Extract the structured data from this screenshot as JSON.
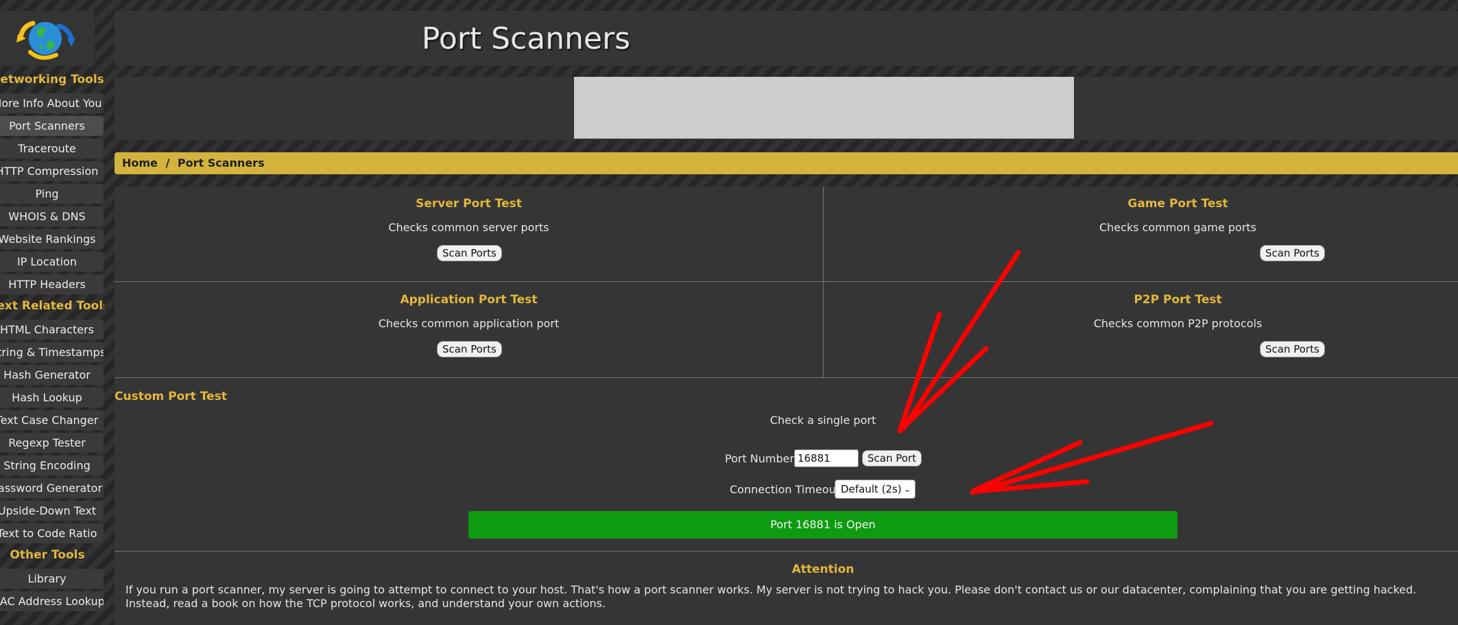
{
  "header": {
    "title": "Port Scanners"
  },
  "breadcrumb": {
    "home": "Home",
    "separator": "/",
    "current": "Port Scanners"
  },
  "sidebar": {
    "sections": [
      {
        "heading": "Networking Tools",
        "items": [
          "More Info About You",
          "Port Scanners",
          "Traceroute",
          "HTTP Compression",
          "Ping",
          "WHOIS & DNS",
          "Website Rankings",
          "IP Location",
          "HTTP Headers"
        ]
      },
      {
        "heading": "Text Related Tools",
        "items": [
          "HTML Characters",
          "String & Timestamps",
          "Hash Generator",
          "Hash Lookup",
          "Text Case Changer",
          "Regexp Tester",
          "String Encoding",
          "Password Generator",
          "Upside-Down Text",
          "Text to Code Ratio"
        ]
      },
      {
        "heading": "Other Tools",
        "items": [
          "Library",
          "MAC Address Lookup"
        ]
      }
    ],
    "active_item": "Port Scanners"
  },
  "tests": {
    "server": {
      "title": "Server Port Test",
      "desc": "Checks common server ports",
      "button": "Scan Ports"
    },
    "game": {
      "title": "Game Port Test",
      "desc": "Checks common game ports",
      "button": "Scan Ports"
    },
    "application": {
      "title": "Application Port Test",
      "desc": "Checks common application port",
      "button": "Scan Ports"
    },
    "p2p": {
      "title": "P2P Port Test",
      "desc": "Checks common P2P protocols",
      "button": "Scan Ports"
    }
  },
  "custom": {
    "title": "Custom Port Test",
    "desc": "Check a single port",
    "port_label": "Port Number:",
    "port_value": "16881",
    "scan_button": "Scan Port",
    "timeout_label": "Connection Timeout:",
    "timeout_value": "Default (2s)",
    "result": "Port 16881 is Open",
    "result_color": "#0f9b11"
  },
  "attention": {
    "title": "Attention",
    "text": "If you run a port scanner, my server is going to attempt to connect to your host. That's how a port scanner works. My server is not trying to hack you. Please don't contact us or our datacenter, complaining that you are getting hacked. Instead, read a book on how the TCP protocol works, and understand your own actions."
  },
  "colors": {
    "accent": "#e3b73a",
    "breadcrumb_bg": "#d4b23e",
    "panel_bg": "#353535",
    "annotation_arrows": "#ff0000"
  },
  "icons": {
    "logo": "globe-with-arrows-icon"
  }
}
